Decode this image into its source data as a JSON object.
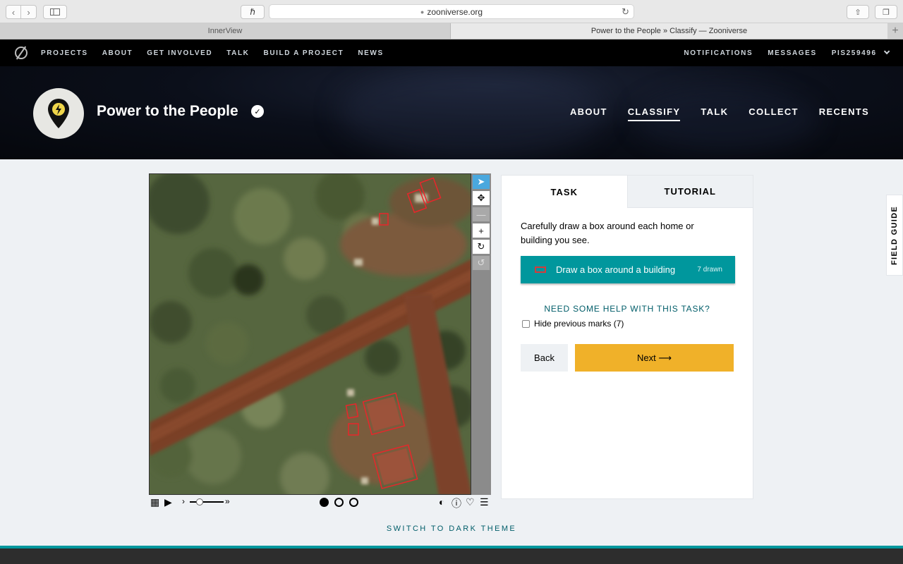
{
  "browser": {
    "url": "zooniverse.org",
    "tabs": [
      {
        "label": "InnerView"
      },
      {
        "label": "Power to the People » Classify — Zooniverse"
      }
    ]
  },
  "top_nav": {
    "left": [
      "PROJECTS",
      "ABOUT",
      "GET INVOLVED",
      "TALK",
      "BUILD A PROJECT",
      "NEWS"
    ],
    "right": [
      "NOTIFICATIONS",
      "MESSAGES"
    ],
    "user": "PIS259496"
  },
  "project": {
    "title": "Power to the People",
    "nav": [
      "ABOUT",
      "CLASSIFY",
      "TALK",
      "COLLECT",
      "RECENTS"
    ],
    "active_nav": "CLASSIFY"
  },
  "task_panel": {
    "tabs": [
      "TASK",
      "TUTORIAL"
    ],
    "active_tab": "TASK",
    "instruction": "Carefully draw a box around each home or building you see.",
    "tool": {
      "label": "Draw a box around a building",
      "count": "7 drawn",
      "color": "#00979d"
    },
    "help": "NEED SOME HELP WITH THIS TASK?",
    "hide_marks": {
      "label": "Hide previous marks (7)",
      "checked": false
    },
    "back": "Back",
    "next": "Next ⟶"
  },
  "field_guide": "FIELD GUIDE",
  "theme_switch": "SWITCH TO DARK THEME",
  "subject_viewer": {
    "tools": [
      "pointer-icon",
      "pan-icon",
      "zoom-out-icon",
      "zoom-in-icon",
      "rotate-icon",
      "reset-icon"
    ],
    "frames": {
      "count": 3,
      "current": 1
    }
  },
  "colors": {
    "teal": "#00979d",
    "yellow": "#f0b129",
    "mark_red": "#e8262b"
  }
}
